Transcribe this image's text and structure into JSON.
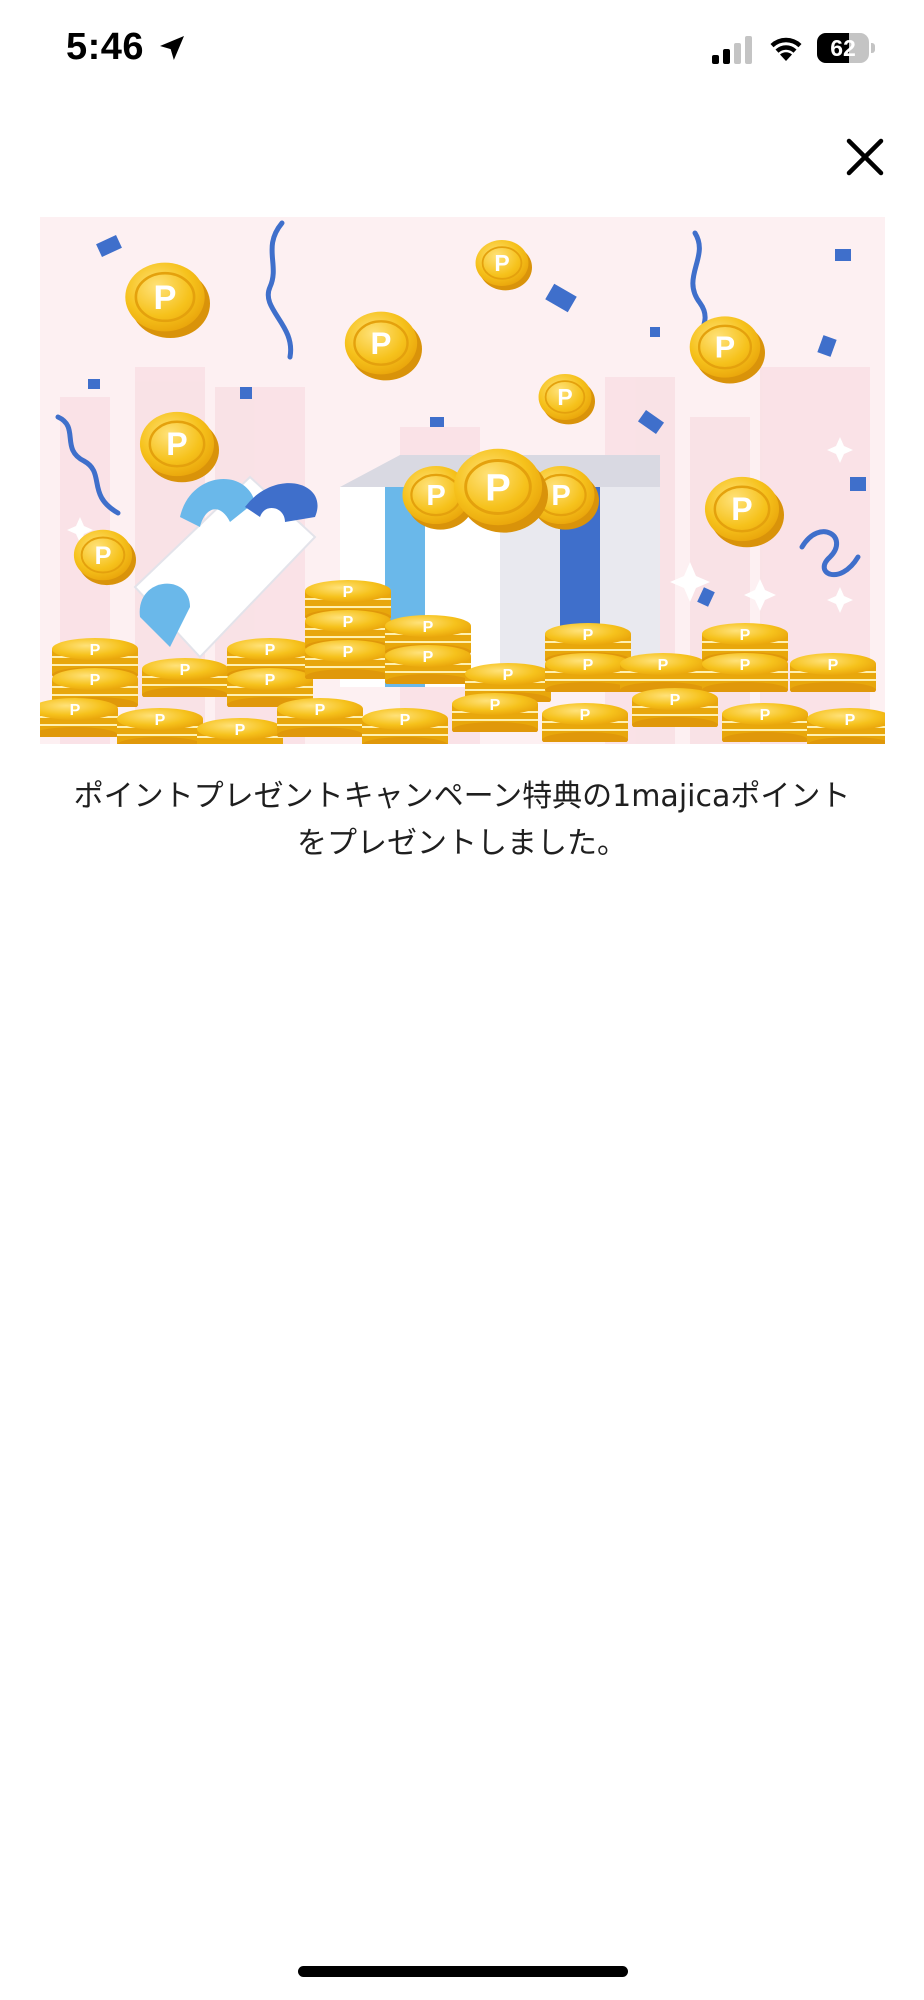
{
  "status_bar": {
    "time": "5:46",
    "battery_level": "62",
    "battery_fraction": 0.62,
    "icons": [
      "location-arrow-icon",
      "cellular-signal-icon",
      "wifi-icon",
      "battery-icon"
    ]
  },
  "dialog": {
    "close_icon": "close-icon",
    "banner_image": "gold-points-gift-box-illustration",
    "message": "ポイントプレゼントキャンペーン特典の1majicaポイントをプレゼントしました。"
  },
  "colors": {
    "background": "#ffffff",
    "banner_background": "#fdeef0",
    "coin_gold": "#f3b914",
    "ribbon_blue": "#3f6fcb",
    "ribbon_light_blue": "#6ab8ea",
    "text": "#1f1f1f"
  }
}
